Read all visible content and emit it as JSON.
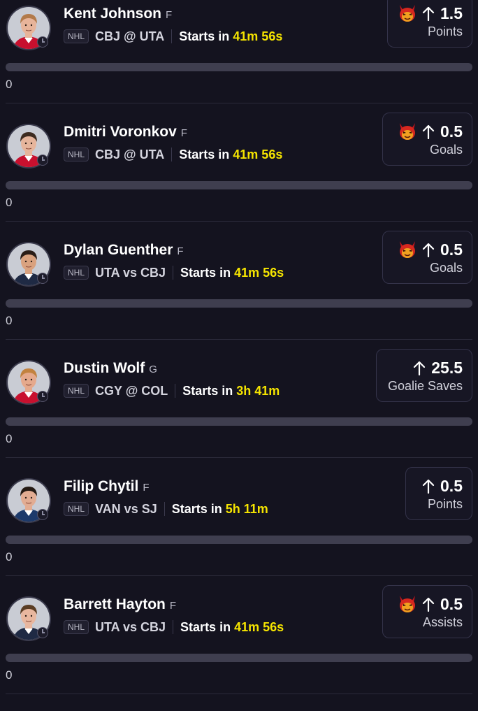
{
  "props": [
    {
      "player": "Kent Johnson",
      "position": "F",
      "league": "NHL",
      "matchup": "CBJ @ UTA",
      "starts_label": "Starts in",
      "countdown": "41m 56s",
      "line": "1.5",
      "stat": "Points",
      "demon": true,
      "progress": 0,
      "count": "0",
      "skin": "#e7b49a",
      "hair": "#b27a4a",
      "jersey": "#c8102e"
    },
    {
      "player": "Dmitri Voronkov",
      "position": "F",
      "league": "NHL",
      "matchup": "CBJ @ UTA",
      "starts_label": "Starts in",
      "countdown": "41m 56s",
      "line": "0.5",
      "stat": "Goals",
      "demon": true,
      "progress": 0,
      "count": "0",
      "skin": "#e6b59c",
      "hair": "#3d2b20",
      "jersey": "#c8102e"
    },
    {
      "player": "Dylan Guenther",
      "position": "F",
      "league": "NHL",
      "matchup": "UTA vs CBJ",
      "starts_label": "Starts in",
      "countdown": "41m 56s",
      "line": "0.5",
      "stat": "Goals",
      "demon": true,
      "progress": 0,
      "count": "0",
      "skin": "#d9a27f",
      "hair": "#2a1d17",
      "jersey": "#1f2a44"
    },
    {
      "player": "Dustin Wolf",
      "position": "G",
      "league": "NHL",
      "matchup": "CGY @ COL",
      "starts_label": "Starts in",
      "countdown": "3h 41m",
      "line": "25.5",
      "stat": "Goalie Saves",
      "demon": false,
      "progress": 0,
      "count": "0",
      "skin": "#e5a98c",
      "hair": "#c2823f",
      "jersey": "#c8102e"
    },
    {
      "player": "Filip Chytil",
      "position": "F",
      "league": "NHL",
      "matchup": "VAN vs SJ",
      "starts_label": "Starts in",
      "countdown": "5h 11m",
      "line": "0.5",
      "stat": "Points",
      "demon": false,
      "progress": 0,
      "count": "0",
      "skin": "#e2ac92",
      "hair": "#241a14",
      "jersey": "#1d3a6b"
    },
    {
      "player": "Barrett Hayton",
      "position": "F",
      "league": "NHL",
      "matchup": "UTA vs CBJ",
      "starts_label": "Starts in",
      "countdown": "41m 56s",
      "line": "0.5",
      "stat": "Assists",
      "demon": true,
      "progress": 0,
      "count": "0",
      "skin": "#e8b79f",
      "hair": "#5a3d24",
      "jersey": "#1f2a44"
    }
  ]
}
